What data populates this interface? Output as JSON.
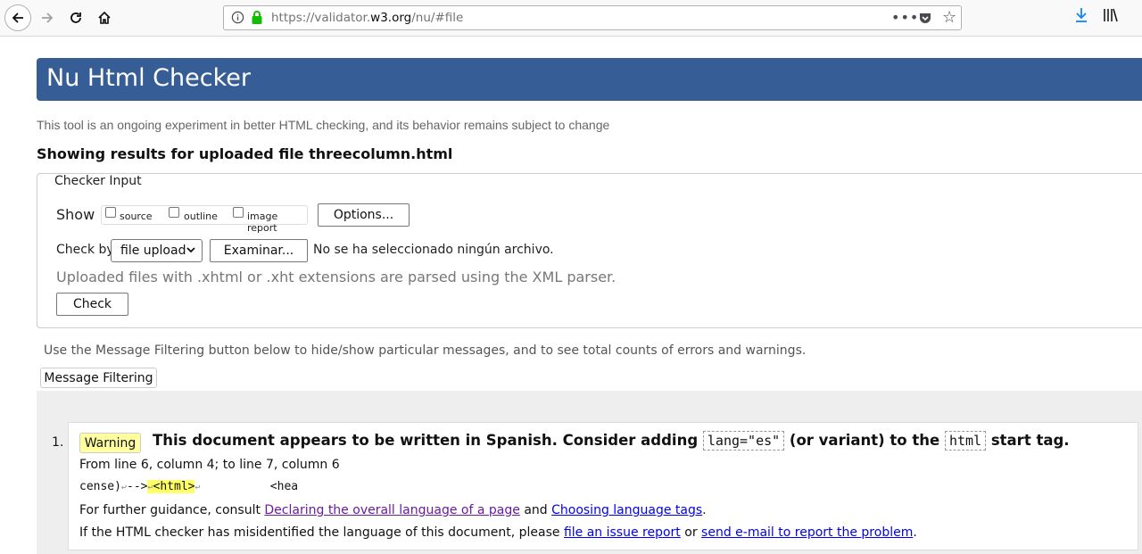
{
  "browser": {
    "url_prefix": "https://validator.",
    "url_domain": "w3.org",
    "url_suffix": "/nu/#file"
  },
  "page": {
    "title": "Nu Html Checker",
    "tagline": "This tool is an ongoing experiment in better HTML checking, and its behavior remains subject to change",
    "showing": "Showing results for uploaded file threecolumn.html"
  },
  "checker_input": {
    "legend": "Checker Input",
    "show_label": "Show",
    "show_options": [
      "source",
      "outline",
      "image report"
    ],
    "options_button": "Options...",
    "check_by_label": "Check by",
    "check_by_value": "file upload",
    "browse_button": "Examinar...",
    "no_file_text": "No se ha seleccionado ningún archivo.",
    "xml_note": "Uploaded files with .xhtml or .xht extensions are parsed using the XML parser.",
    "check_button": "Check"
  },
  "filtering": {
    "note": "Use the Message Filtering button below to hide/show particular messages, and to see total counts of errors and warnings.",
    "button": "Message Filtering"
  },
  "message": {
    "number": "1.",
    "badge": "Warning",
    "title_part1": "This document appears to be written in Spanish. Consider adding",
    "code1": "lang=\"es\"",
    "title_part2": "(or variant) to the",
    "code2": "html",
    "title_part3": "start tag.",
    "location": "From line 6, column 4; to line 7, column 6",
    "extract_before": "cense)",
    "extract_mid": "-->",
    "extract_highlight": "<html>",
    "extract_after": "<hea",
    "guidance_prefix": "For further guidance, consult",
    "guidance_link1": "Declaring the overall language of a page",
    "guidance_and": "and",
    "guidance_link2": "Choosing language tags",
    "guidance_end": ".",
    "issue_prefix": "If the HTML checker has misidentified the language of this document, please",
    "issue_link1": "file an issue report",
    "issue_or": "or",
    "issue_link2": "send e-mail to report the problem",
    "issue_end": "."
  }
}
